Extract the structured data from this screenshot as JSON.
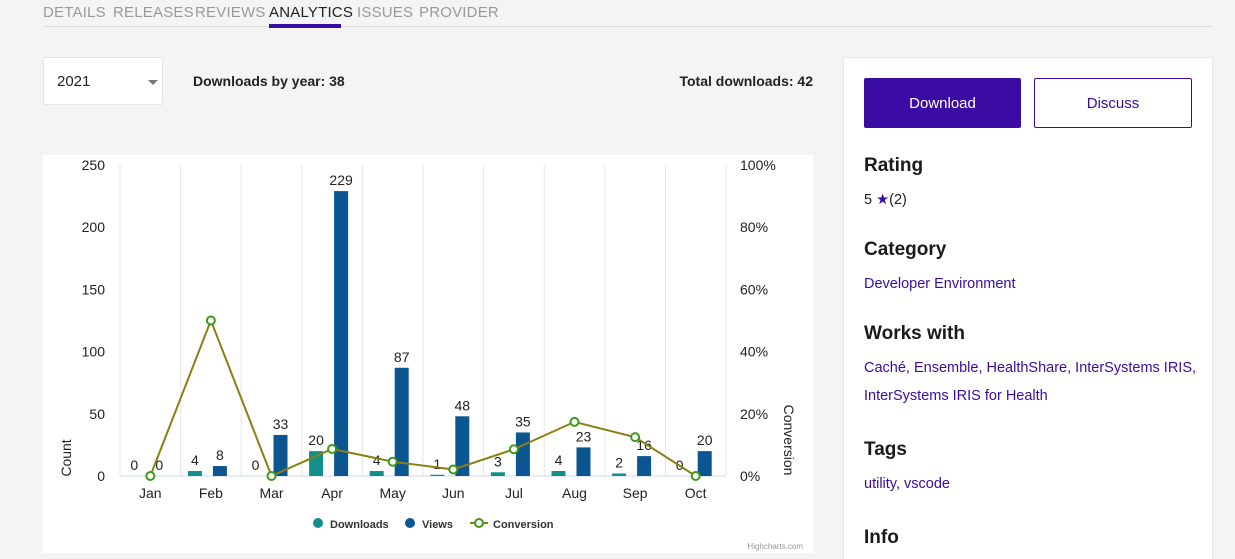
{
  "tabs": [
    "DETAILS",
    "RELEASES",
    "REVIEWS",
    "ANALYTICS",
    "ISSUES",
    "PROVIDER"
  ],
  "active_tab": "ANALYTICS",
  "year_select": {
    "value": "2021"
  },
  "downloads_by_year": "Downloads by year: 38",
  "total_downloads": "Total downloads: 42",
  "actions": {
    "download_label": "Download",
    "discuss_label": "Discuss"
  },
  "rating": {
    "title": "Rating",
    "value": "5",
    "star": "★",
    "count": "(2)"
  },
  "category": {
    "title": "Category",
    "value": "Developer Environment"
  },
  "works_with": {
    "title": "Works with",
    "line1": "Caché, Ensemble, HealthShare, InterSystems IRIS,",
    "line2": "InterSystems IRIS for Health"
  },
  "tags": {
    "title": "Tags",
    "value": "utility, vscode"
  },
  "info": {
    "title": "Info"
  },
  "colors": {
    "accent": "#3a0ca3",
    "downloads": "#128f8b",
    "views": "#0b5591",
    "conversion": "#8a7f12",
    "conversion_marker": "#3d9a1a"
  },
  "chart_data": {
    "type": "bar",
    "categories": [
      "Jan",
      "Feb",
      "Mar",
      "Apr",
      "May",
      "Jun",
      "Jul",
      "Aug",
      "Sep",
      "Oct"
    ],
    "series": [
      {
        "name": "Downloads",
        "type": "bar",
        "axis": "left",
        "values": [
          0,
          4,
          0,
          20,
          4,
          1,
          3,
          4,
          2,
          0
        ]
      },
      {
        "name": "Views",
        "type": "bar",
        "axis": "left",
        "values": [
          0,
          8,
          33,
          229,
          87,
          48,
          35,
          23,
          16,
          20
        ]
      },
      {
        "name": "Conversion",
        "type": "line",
        "axis": "right",
        "values": [
          0,
          50,
          0,
          8.7,
          4.6,
          2.1,
          8.6,
          17.4,
          12.5,
          0
        ]
      }
    ],
    "ylabel": "Count",
    "y2label": "Conversion",
    "ylim": [
      0,
      250
    ],
    "y_ticks": [
      "0",
      "50",
      "100",
      "150",
      "200",
      "250"
    ],
    "y2lim": [
      0,
      100
    ],
    "y2_ticks": [
      "0%",
      "20%",
      "40%",
      "60%",
      "80%",
      "100%"
    ],
    "grid": "vertical",
    "legend": "bottom-center",
    "credits": "Highcharts.com"
  }
}
